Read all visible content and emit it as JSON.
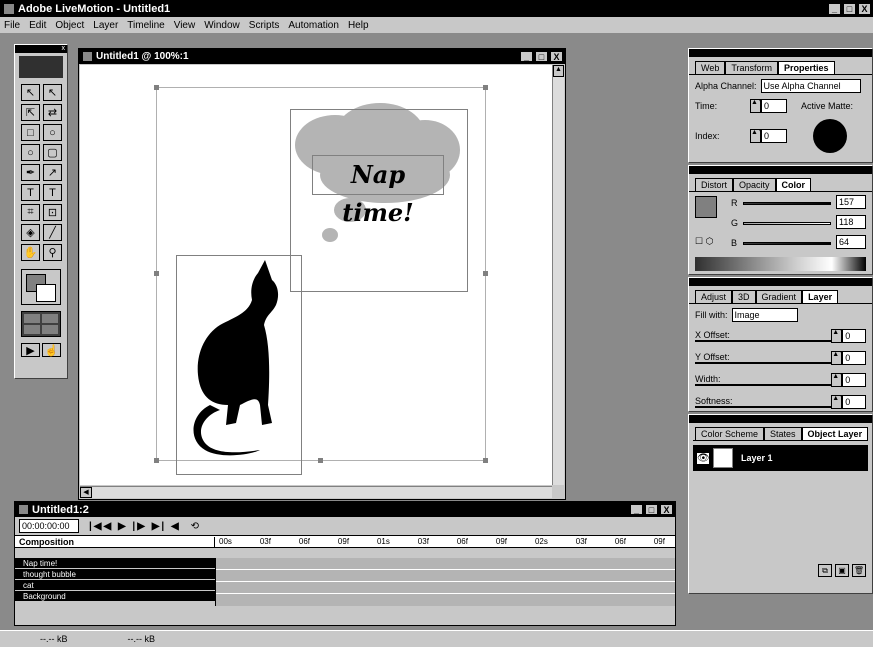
{
  "app": {
    "title": "Adobe LiveMotion - Untitled1",
    "win_buttons": [
      "_",
      "□",
      "X"
    ]
  },
  "menu": [
    "File",
    "Edit",
    "Object",
    "Layer",
    "Timeline",
    "View",
    "Window",
    "Scripts",
    "Automation",
    "Help"
  ],
  "doc": {
    "title": "Untitled1 @ 100%:1",
    "art_text": "Nap time!"
  },
  "properties_panel": {
    "tabs": [
      "Web",
      "Transform",
      "Properties"
    ],
    "alpha_label": "Alpha Channel:",
    "alpha_value": "Use Alpha Channel",
    "time_label": "Time:",
    "time_value": "0",
    "index_label": "Index:",
    "index_value": "0",
    "matte_label": "Active Matte:"
  },
  "color_panel": {
    "tabs": [
      "Distort",
      "Opacity",
      "Color"
    ],
    "r_label": "R",
    "r_value": "157",
    "g_label": "G",
    "g_value": "118",
    "b_label": "B",
    "b_value": "64"
  },
  "layer_panel": {
    "tabs": [
      "Adjust",
      "3D",
      "Gradient",
      "Layer"
    ],
    "fill_label": "Fill with:",
    "fill_value": "Image",
    "xoff_label": "X Offset:",
    "xoff_value": "0",
    "yoff_label": "Y Offset:",
    "yoff_value": "0",
    "width_label": "Width:",
    "width_value": "0",
    "soft_label": "Softness:",
    "soft_value": "0"
  },
  "object_panel": {
    "tabs": [
      "Color Scheme",
      "States",
      "Object Layer"
    ],
    "layer_name": "Layer 1"
  },
  "timeline": {
    "title": "Untitled1:2",
    "timecode": "00:00:00:00",
    "composition_label": "Composition",
    "ruler": [
      "00s",
      "03f",
      "06f",
      "09f",
      "01s",
      "03f",
      "06f",
      "09f",
      "02s",
      "03f",
      "06f",
      "09f"
    ],
    "layers": [
      "Nap time!",
      "thought bubble",
      "cat",
      "Background"
    ]
  },
  "status": {
    "left": "--.-- kB",
    "right": "--.-- kB"
  }
}
